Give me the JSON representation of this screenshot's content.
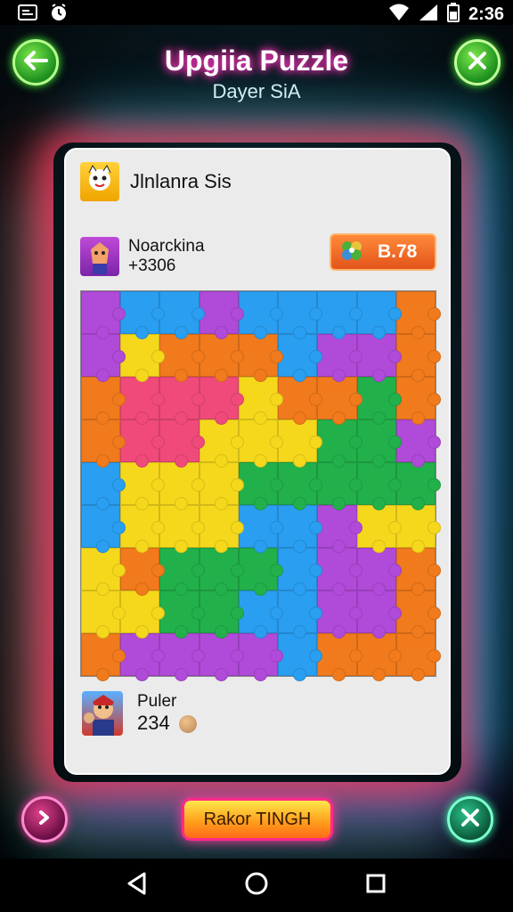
{
  "status_bar": {
    "time": "2:36",
    "icons": [
      "screenshot-icon",
      "alarm-icon",
      "wifi-icon",
      "signal-icon",
      "battery-icon"
    ]
  },
  "header": {
    "title": "Upgiia Puzzle",
    "subtitle": "Dayer SiA",
    "back_icon": "arrow-left-icon",
    "close_icon": "close-icon"
  },
  "card": {
    "player1": {
      "name": "Jlnlanra Sis"
    },
    "player2": {
      "name": "Noarckina",
      "score": "+3306"
    },
    "badge": {
      "icon": "clover-icon",
      "value": "B.78"
    },
    "puzzle": {
      "rows": 9,
      "cols": 9,
      "colors": {
        "p": "#b04ad8",
        "b": "#2a9ef0",
        "o": "#f07a1c",
        "y": "#f5d81c",
        "k": "#f04a7a",
        "g": "#22b04a"
      },
      "grid": [
        [
          "p",
          "b",
          "b",
          "p",
          "b",
          "b",
          "b",
          "b",
          "o"
        ],
        [
          "p",
          "y",
          "o",
          "o",
          "o",
          "b",
          "p",
          "p",
          "o"
        ],
        [
          "o",
          "k",
          "k",
          "k",
          "y",
          "o",
          "o",
          "g",
          "o"
        ],
        [
          "o",
          "k",
          "k",
          "y",
          "y",
          "y",
          "g",
          "g",
          "p"
        ],
        [
          "b",
          "y",
          "y",
          "y",
          "g",
          "g",
          "g",
          "g",
          "g"
        ],
        [
          "b",
          "y",
          "y",
          "y",
          "b",
          "b",
          "p",
          "y",
          "y"
        ],
        [
          "y",
          "o",
          "g",
          "g",
          "g",
          "b",
          "p",
          "p",
          "o"
        ],
        [
          "y",
          "y",
          "g",
          "g",
          "b",
          "b",
          "p",
          "p",
          "o"
        ],
        [
          "o",
          "p",
          "p",
          "p",
          "p",
          "b",
          "o",
          "o",
          "o"
        ]
      ]
    },
    "bottom_player": {
      "name": "Puler",
      "score": "234"
    }
  },
  "bottom_bar": {
    "left_icon": "swap-icon",
    "main_button": "Rakor TINGH",
    "right_icon": "close-icon"
  },
  "nav_bar": {
    "icons": [
      "back-triangle-icon",
      "home-circle-icon",
      "recents-square-icon"
    ]
  }
}
